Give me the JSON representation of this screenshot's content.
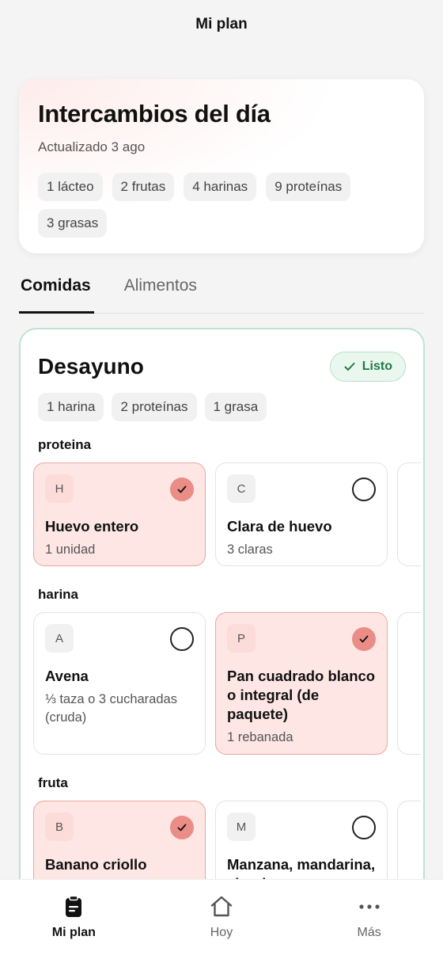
{
  "header": {
    "title": "Mi plan"
  },
  "summary": {
    "title": "Intercambios del día",
    "updated": "Actualizado 3 ago",
    "chips": [
      "1 lácteo",
      "2 frutas",
      "4 harinas",
      "9 proteínas",
      "3 grasas"
    ]
  },
  "tabs": [
    {
      "label": "Comidas",
      "active": true
    },
    {
      "label": "Alimentos",
      "active": false
    }
  ],
  "meal": {
    "title": "Desayuno",
    "status": "Listo",
    "chips": [
      "1 harina",
      "2 proteínas",
      "1 grasa"
    ],
    "sections": [
      {
        "title": "proteina",
        "cards": [
          {
            "initial": "H",
            "name": "Huevo entero",
            "qty": "1 unidad",
            "selected": true
          },
          {
            "initial": "C",
            "name": "Clara de huevo",
            "qty": "3 claras",
            "selected": false
          }
        ]
      },
      {
        "title": "harina",
        "cards": [
          {
            "initial": "A",
            "name": "Avena",
            "qty": "⅓ taza o 3 cucharadas (cruda)",
            "selected": false
          },
          {
            "initial": "P",
            "name": "Pan cuadrado blanco o integral (de paquete)",
            "qty": "1 rebanada",
            "selected": true
          }
        ]
      },
      {
        "title": "fruta",
        "cards": [
          {
            "initial": "B",
            "name": "Banano criollo",
            "qty": "",
            "selected": true
          },
          {
            "initial": "M",
            "name": "Manzana, mandarina, ciruela o",
            "qty": "",
            "selected": false
          }
        ]
      }
    ]
  },
  "nav": [
    {
      "label": "Mi plan",
      "icon": "clipboard-icon",
      "active": true
    },
    {
      "label": "Hoy",
      "icon": "home-icon",
      "active": false
    },
    {
      "label": "Más",
      "icon": "more-icon",
      "active": false
    }
  ],
  "colors": {
    "accent_green": "#1f7a45",
    "selected_bg": "#fde6e4",
    "selected_check": "#ea8d86"
  }
}
